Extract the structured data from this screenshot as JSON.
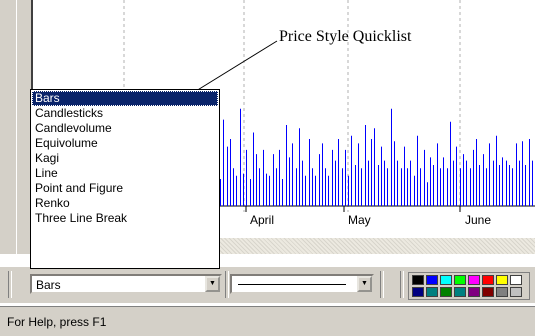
{
  "annotation": {
    "callout_text": "Price Style Quicklist"
  },
  "chart": {
    "months": [
      "April",
      "May",
      "June"
    ],
    "volume_bars": [
      0.25,
      0.8,
      0.55,
      0.62,
      0.35,
      0.28,
      0.9,
      0.3,
      0.52,
      0.25,
      0.68,
      0.48,
      0.35,
      0.52,
      0.3,
      0.28,
      0.48,
      0.35,
      0.52,
      0.25,
      0.75,
      0.45,
      0.58,
      0.35,
      0.72,
      0.42,
      0.28,
      0.62,
      0.35,
      0.28,
      0.48,
      0.58,
      0.35,
      0.28,
      0.52,
      0.42,
      0.62,
      0.35,
      0.52,
      0.28,
      0.65,
      0.38,
      0.58,
      0.35,
      0.75,
      0.42,
      0.62,
      0.72,
      0.38,
      0.55,
      0.42,
      0.35,
      0.9,
      0.6,
      0.42,
      0.35,
      0.55,
      0.35,
      0.42,
      0.28,
      0.65,
      0.35,
      0.52,
      0.22,
      0.45,
      0.38,
      0.58,
      0.35,
      0.45,
      0.35,
      0.78,
      0.42,
      0.55,
      0.35,
      0.48,
      0.42,
      0.35,
      0.52,
      0.62,
      0.38,
      0.48,
      0.35,
      0.58,
      0.42,
      0.65,
      0.38,
      0.45,
      0.42,
      0.38,
      0.35,
      0.58,
      0.42,
      0.6,
      0.38,
      0.62,
      0.42
    ]
  },
  "price_style_list": {
    "items": [
      "Bars",
      "Candlesticks",
      "Candlevolume",
      "Equivolume",
      "Kagi",
      "Line",
      "Point and Figure",
      "Renko",
      "Three Line Break"
    ],
    "selected_index": 0
  },
  "toolbar": {
    "price_style_value": "Bars",
    "dropdown_arrow": "▼",
    "line_style": "solid"
  },
  "palette": {
    "colors": [
      "#000000",
      "#0000ff",
      "#00ffff",
      "#00ff00",
      "#ff00ff",
      "#ff0000",
      "#ffff00",
      "#ffffff",
      "#000080",
      "#008080",
      "#008000",
      "#008080",
      "#800080",
      "#800000",
      "#808080",
      "#c0c0c0"
    ]
  },
  "status": {
    "text": "For Help, press F1"
  },
  "colors": {
    "volume_bar": "#0000ff",
    "selection": "#0a246a",
    "chrome": "#d4d0c8"
  }
}
